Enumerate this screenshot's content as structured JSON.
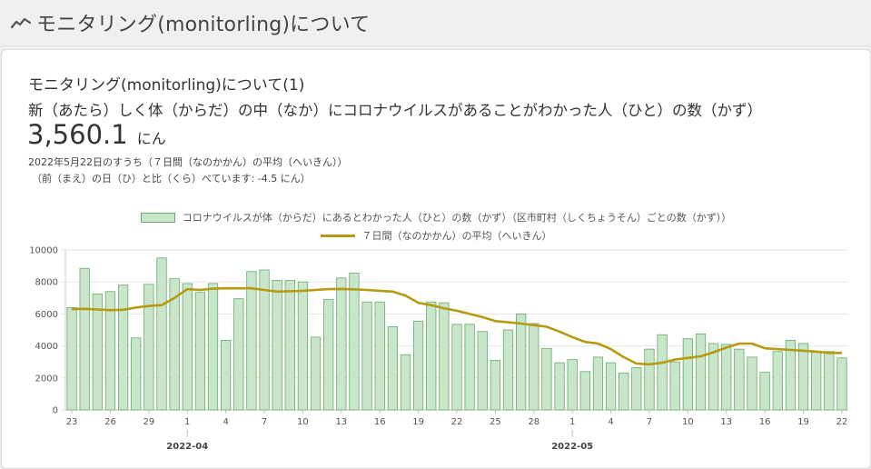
{
  "header": {
    "title": "モニタリング(monitorling)について",
    "icon": "trend-line-icon"
  },
  "card": {
    "title": "モニタリング(monitorling)について(1)",
    "subtitle": "新（あたら）しく体（からだ）の中（なか）にコロナウイルスがあることがわかった人（ひと）の数（かず）",
    "value": "3,560.1",
    "unit": "にん",
    "note1": "2022年5月22日のすうち（７日間（なのかかん）の平均（へいきん））",
    "note2": "（前（まえ）の日（ひ）と比（くら）べています: -4.5 にん）"
  },
  "colors": {
    "bar_fill": "#c8e6c9",
    "bar_stroke": "#6aaa6f",
    "line": "#b59a12",
    "grid": "#e6e6e6"
  },
  "chart_data": {
    "type": "bar",
    "legend_position": "top",
    "grid": true,
    "ylim": [
      0,
      10000
    ],
    "y_ticks": [
      "10000",
      "8000",
      "6000",
      "4000",
      "2000",
      "0"
    ],
    "x_ticks": [
      "23",
      "26",
      "29",
      "1",
      "4",
      "7",
      "10",
      "13",
      "16",
      "19",
      "22",
      "25",
      "28",
      "1",
      "4",
      "7",
      "10",
      "13",
      "16",
      "19",
      "22"
    ],
    "months": [
      "2022-04",
      "2022-05"
    ],
    "x": [
      "2022-03-23",
      "2022-03-24",
      "2022-03-25",
      "2022-03-26",
      "2022-03-27",
      "2022-03-28",
      "2022-03-29",
      "2022-03-30",
      "2022-03-31",
      "2022-04-01",
      "2022-04-02",
      "2022-04-03",
      "2022-04-04",
      "2022-04-05",
      "2022-04-06",
      "2022-04-07",
      "2022-04-08",
      "2022-04-09",
      "2022-04-10",
      "2022-04-11",
      "2022-04-12",
      "2022-04-13",
      "2022-04-14",
      "2022-04-15",
      "2022-04-16",
      "2022-04-17",
      "2022-04-18",
      "2022-04-19",
      "2022-04-20",
      "2022-04-21",
      "2022-04-22",
      "2022-04-23",
      "2022-04-24",
      "2022-04-25",
      "2022-04-26",
      "2022-04-27",
      "2022-04-28",
      "2022-04-29",
      "2022-04-30",
      "2022-05-01",
      "2022-05-02",
      "2022-05-03",
      "2022-05-04",
      "2022-05-05",
      "2022-05-06",
      "2022-05-07",
      "2022-05-08",
      "2022-05-09",
      "2022-05-10",
      "2022-05-11",
      "2022-05-12",
      "2022-05-13",
      "2022-05-14",
      "2022-05-15",
      "2022-05-16",
      "2022-05-17",
      "2022-05-18",
      "2022-05-19",
      "2022-05-20",
      "2022-05-21",
      "2022-05-22"
    ],
    "series": [
      {
        "name": "コロナウイルスが体（からだ）にあるとわかった人（ひと）の数（かず）（区市町村（しくちょうそん）ごとの数（かず））",
        "type": "bar",
        "values": [
          6400,
          8850,
          7250,
          7400,
          7800,
          4500,
          7850,
          9500,
          8200,
          7900,
          7350,
          7900,
          4350,
          6950,
          8650,
          8750,
          8100,
          8100,
          8000,
          4550,
          6900,
          8250,
          8550,
          6750,
          6750,
          5200,
          3450,
          5550,
          6750,
          6700,
          5350,
          5350,
          4900,
          3100,
          5000,
          6000,
          5400,
          3850,
          2950,
          3150,
          2400,
          3300,
          2950,
          2300,
          2650,
          3800,
          4700,
          3000,
          4450,
          4750,
          4150,
          4100,
          3800,
          3300,
          2350,
          3650,
          4350,
          4150,
          3600,
          3650,
          3250
        ]
      },
      {
        "name": "７日間（なのかかん）の平均（へいきん）",
        "type": "line",
        "values": [
          6300,
          6320,
          6280,
          6240,
          6260,
          6400,
          6500,
          6550,
          7000,
          7550,
          7500,
          7580,
          7600,
          7600,
          7600,
          7500,
          7400,
          7420,
          7450,
          7500,
          7550,
          7560,
          7540,
          7500,
          7450,
          7400,
          7150,
          6700,
          6550,
          6350,
          6200,
          6000,
          5800,
          5550,
          5480,
          5400,
          5300,
          5200,
          4900,
          4550,
          4250,
          4150,
          3800,
          3300,
          2900,
          2850,
          2950,
          3150,
          3250,
          3350,
          3600,
          3900,
          4150,
          4150,
          3850,
          3800,
          3750,
          3700,
          3650,
          3560,
          3560
        ]
      }
    ]
  }
}
